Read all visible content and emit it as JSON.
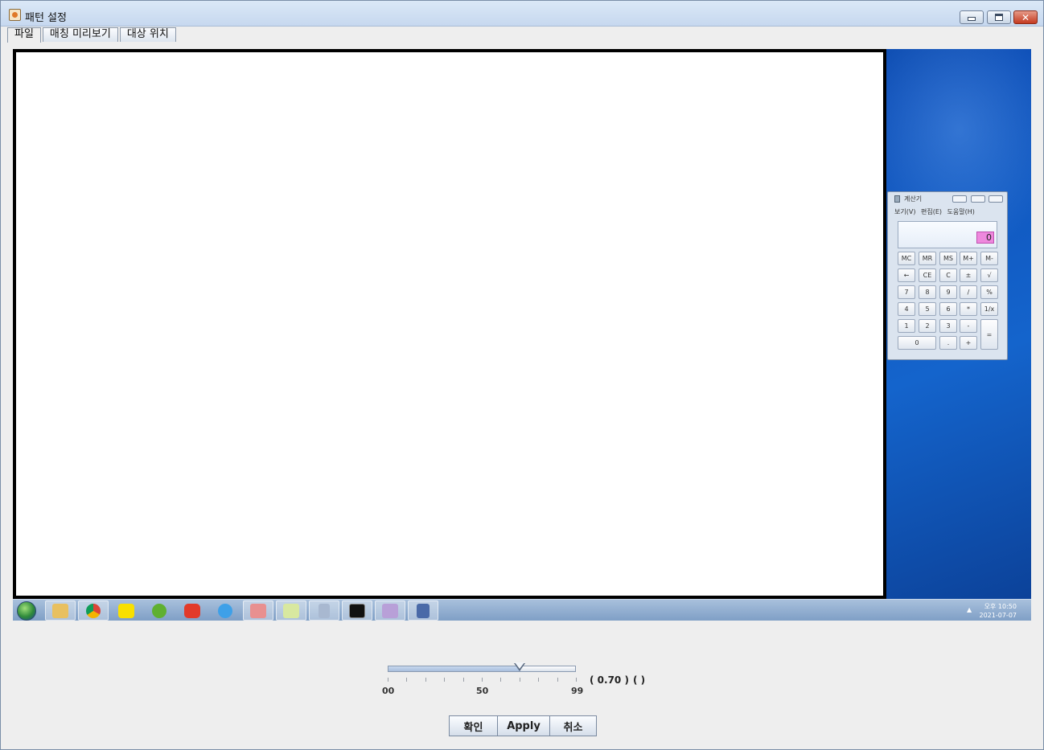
{
  "window": {
    "title": "패턴 설정",
    "icons": {
      "app": "java-cup-icon"
    }
  },
  "tabs": [
    {
      "label": "파일"
    },
    {
      "label": "매칭 미리보기"
    },
    {
      "label": "대상 위치"
    }
  ],
  "capture": {
    "calculator": {
      "title": "계산기",
      "menu": "보기(V)  편집(E)  도움말(H)",
      "display": "0",
      "keys": [
        [
          "MC",
          "MR",
          "MS",
          "M+",
          "M-"
        ],
        [
          "←",
          "CE",
          "C",
          "±",
          "√"
        ],
        [
          "7",
          "8",
          "9",
          "/",
          "%"
        ],
        [
          "4",
          "5",
          "6",
          "*",
          "1/x"
        ],
        [
          "1",
          "2",
          "3",
          "-",
          "="
        ],
        [
          "0",
          ".",
          "+"
        ]
      ]
    },
    "taskbar": {
      "items": [
        "explorer",
        "chrome",
        "kakaotalk",
        "utorrent",
        "app-red",
        "internet-explorer",
        "snipping",
        "notepad",
        "calculator",
        "cmd",
        "paint",
        "save"
      ],
      "clock_line1": "오후 10:50",
      "clock_line2": "2021-07-07"
    }
  },
  "similarity": {
    "value": 0.7,
    "min_label": "00",
    "mid_label": "50",
    "max_label": "99",
    "value_text": "( 0.70 )",
    "extra_text": "(        )"
  },
  "buttons": {
    "ok": "확인",
    "apply": "Apply",
    "cancel": "취소"
  }
}
